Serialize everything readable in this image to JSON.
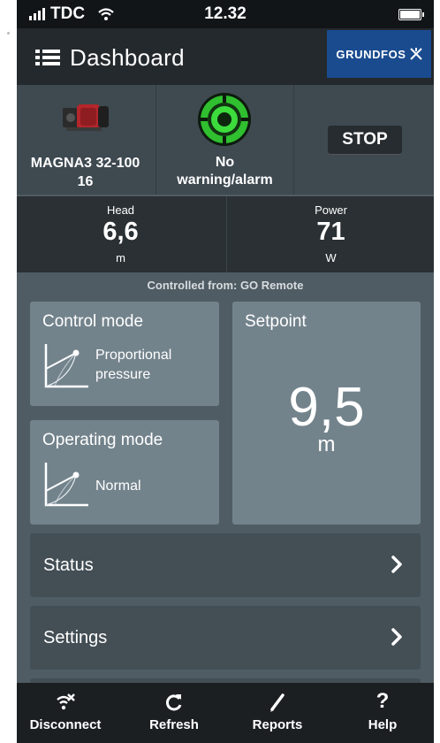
{
  "status_bar": {
    "carrier": "TDC",
    "time": "12.32"
  },
  "header": {
    "title": "Dashboard",
    "brand": "GRUNDFOS"
  },
  "pump": {
    "model": "MAGNA3 32-100",
    "model_line2": "16",
    "alarm_line1": "No",
    "alarm_line2": "warning/alarm",
    "stop_label": "STOP"
  },
  "readings": {
    "head": {
      "label": "Head",
      "value": "6,6",
      "unit": "m"
    },
    "power": {
      "label": "Power",
      "value": "71",
      "unit": "W"
    }
  },
  "controlled_from": "Controlled from: GO Remote",
  "control_mode": {
    "title": "Control mode",
    "line1": "Proportional",
    "line2": "pressure"
  },
  "operating_mode": {
    "title": "Operating mode",
    "value": "Normal"
  },
  "setpoint": {
    "title": "Setpoint",
    "value": "9,5",
    "unit": "m"
  },
  "rows": {
    "status": "Status",
    "settings": "Settings"
  },
  "tabs": {
    "disconnect": "Disconnect",
    "refresh": "Refresh",
    "reports": "Reports",
    "help": "Help",
    "help_glyph": "?"
  },
  "colors": {
    "brand": "#1a4b8f",
    "status_ok": "#3ddc3d",
    "accent_red": "#b3262a"
  }
}
